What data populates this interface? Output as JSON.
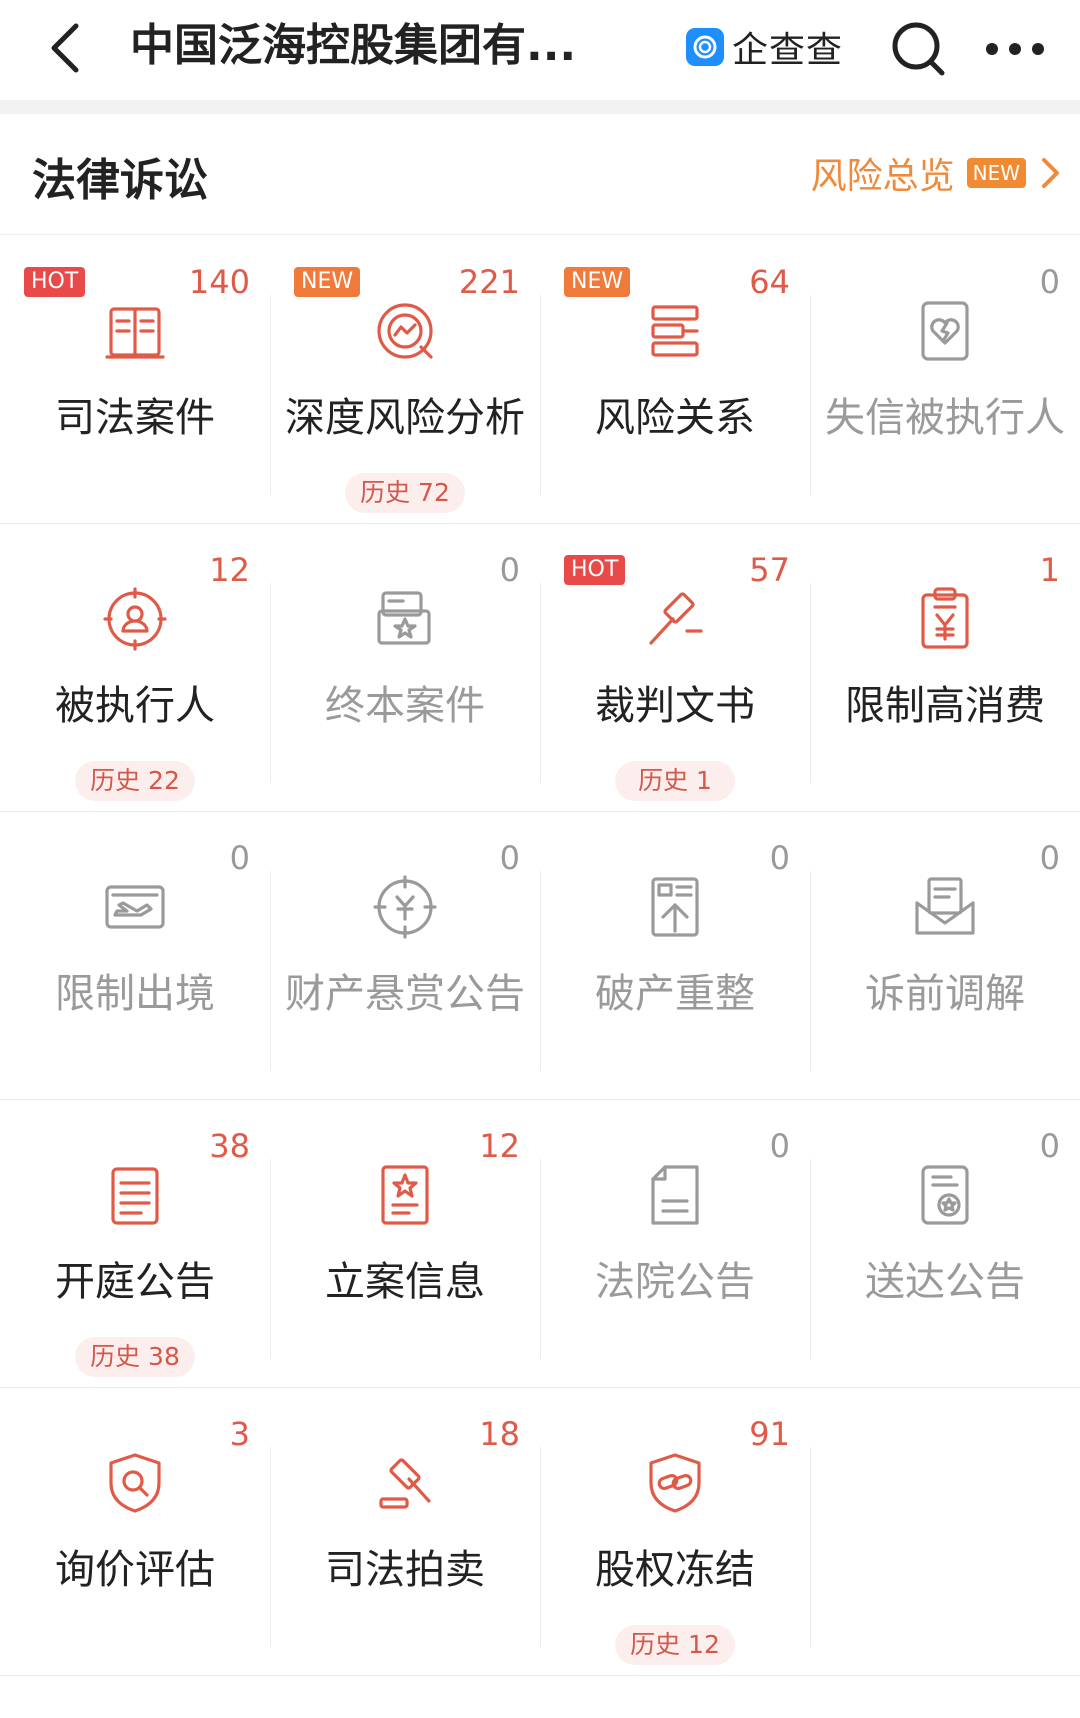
{
  "header": {
    "title": "中国泛海控股集团有...",
    "brand": "企查查"
  },
  "section": {
    "title": "法律诉讼",
    "overview_label": "风险总览",
    "overview_badge": "NEW"
  },
  "colors": {
    "accent": "#e05a48",
    "orange": "#f08b33",
    "muted": "#9a9a9a",
    "hot": "#e84a4a"
  },
  "items": [
    {
      "label": "司法案件",
      "count": "140",
      "badge": "HOT",
      "history": "",
      "icon": "book-icon",
      "active": true
    },
    {
      "label": "深度风险分析",
      "count": "221",
      "badge": "NEW",
      "history": "历史 72",
      "icon": "risk-analysis-icon",
      "active": true
    },
    {
      "label": "风险关系",
      "count": "64",
      "badge": "NEW",
      "history": "",
      "icon": "relation-icon",
      "active": true
    },
    {
      "label": "失信被执行人",
      "count": "0",
      "badge": "",
      "history": "",
      "icon": "broken-heart-card-icon",
      "active": false
    },
    {
      "label": "被执行人",
      "count": "12",
      "badge": "",
      "history": "历史 22",
      "icon": "person-target-icon",
      "active": true
    },
    {
      "label": "终本案件",
      "count": "0",
      "badge": "",
      "history": "",
      "icon": "star-folder-icon",
      "active": false
    },
    {
      "label": "裁判文书",
      "count": "57",
      "badge": "HOT",
      "history": "历史 1",
      "icon": "gavel-icon",
      "active": true
    },
    {
      "label": "限制高消费",
      "count": "1",
      "badge": "",
      "history": "",
      "icon": "yen-clipboard-icon",
      "active": true
    },
    {
      "label": "限制出境",
      "count": "0",
      "badge": "",
      "history": "",
      "icon": "plane-ticket-icon",
      "active": false
    },
    {
      "label": "财产悬赏公告",
      "count": "0",
      "badge": "",
      "history": "",
      "icon": "yen-target-icon",
      "active": false
    },
    {
      "label": "破产重整",
      "count": "0",
      "badge": "",
      "history": "",
      "icon": "bankrupt-doc-icon",
      "active": false
    },
    {
      "label": "诉前调解",
      "count": "0",
      "badge": "",
      "history": "",
      "icon": "mail-doc-icon",
      "active": false
    },
    {
      "label": "开庭公告",
      "count": "38",
      "badge": "",
      "history": "历史 38",
      "icon": "list-doc-icon",
      "active": true
    },
    {
      "label": "立案信息",
      "count": "12",
      "badge": "",
      "history": "",
      "icon": "star-doc-icon",
      "active": true
    },
    {
      "label": "法院公告",
      "count": "0",
      "badge": "",
      "history": "",
      "icon": "page-icon",
      "active": false
    },
    {
      "label": "送达公告",
      "count": "0",
      "badge": "",
      "history": "",
      "icon": "seal-doc-icon",
      "active": false
    },
    {
      "label": "询价评估",
      "count": "3",
      "badge": "",
      "history": "",
      "icon": "shield-search-icon",
      "active": true
    },
    {
      "label": "司法拍卖",
      "count": "18",
      "badge": "",
      "history": "",
      "icon": "auction-hammer-icon",
      "active": true
    },
    {
      "label": "股权冻结",
      "count": "91",
      "badge": "",
      "history": "历史 12",
      "icon": "shield-link-icon",
      "active": true
    }
  ]
}
